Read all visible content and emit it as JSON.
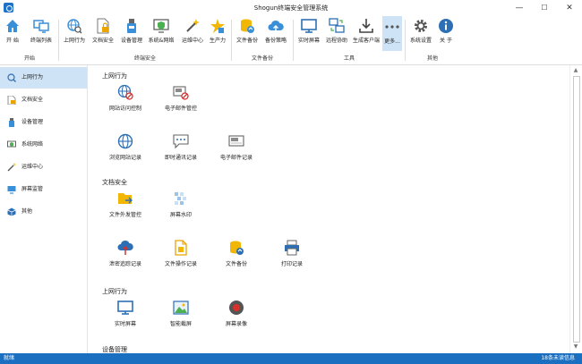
{
  "window": {
    "title": "Shogun终端安全管理系统",
    "minimize": "—",
    "maximize": "☐",
    "close": "✕"
  },
  "ribbon": {
    "groups": [
      "开始",
      "终端安全",
      "文件备份",
      "工具",
      "其他"
    ],
    "buttons": [
      "开 始",
      "终端列表",
      "上网行为",
      "文档安全",
      "设备管理",
      "系统&网络",
      "运维中心",
      "生产力",
      "文件备份",
      "备份策略",
      "实时屏幕",
      "远程协助",
      "生成客户端",
      "更多...",
      "系统设置",
      "关 于"
    ]
  },
  "sidebar": {
    "items": [
      "上网行为",
      "文档安全",
      "设备管理",
      "系统网络",
      "运维中心",
      "屏幕监管",
      "其他"
    ]
  },
  "content": {
    "sections": [
      "上网行为",
      "文档安全",
      "上网行为",
      "设备管理"
    ],
    "cards": [
      "网站访问控制",
      "电子邮件管控",
      "浏览网站记录",
      "即时通讯记录",
      "电子邮件记录",
      "文件外发管控",
      "屏幕水印",
      "泄密追踪记录",
      "文件操作记录",
      "文件备份",
      "打印记录",
      "实时屏幕",
      "智能截屏",
      "屏幕录像"
    ]
  },
  "status": {
    "left": "就绪",
    "right": "18条未读信息"
  },
  "colors": {
    "accent": "#1a6fc0",
    "selected": "#cfe3f7"
  }
}
